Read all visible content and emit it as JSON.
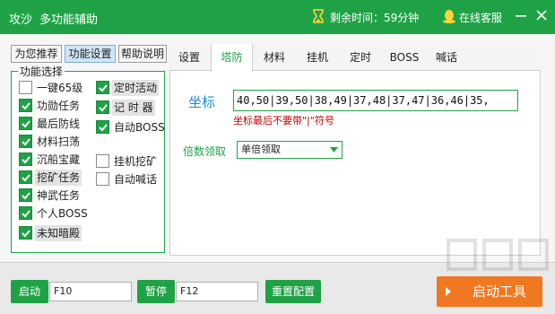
{
  "titlebar": {
    "app_title": "攻沙",
    "subtitle": "多功能辅助",
    "remaining_time": "剩余时间：59分钟",
    "online_service": "在线客服"
  },
  "left_tabs": [
    "为您推荐",
    "功能设置",
    "帮助说明"
  ],
  "function_group": {
    "legend": "功能选择",
    "left_options": [
      {
        "label": "一键65级",
        "checked": false
      },
      {
        "label": "功勋任务",
        "checked": true
      },
      {
        "label": "最后防线",
        "checked": true
      },
      {
        "label": "材料扫荡",
        "checked": true
      },
      {
        "label": "沉船宝藏",
        "checked": true
      },
      {
        "label": "挖矿任务",
        "checked": true
      },
      {
        "label": "神武任务",
        "checked": true
      },
      {
        "label": "个人BOSS",
        "checked": true
      },
      {
        "label": "未知暗殿",
        "checked": true
      }
    ],
    "right_options": [
      {
        "label": "定时活动",
        "checked": true
      },
      {
        "label": "记 时 器",
        "checked": true
      },
      {
        "label": "自动BOSS",
        "checked": true
      },
      {
        "label": "挂机挖矿",
        "checked": false
      },
      {
        "label": "自动喊话",
        "checked": false
      }
    ]
  },
  "right_tabs": [
    "设置",
    "塔防",
    "材料",
    "挂机",
    "定时",
    "BOSS",
    "喊话"
  ],
  "tower_defense": {
    "coord_label": "坐标",
    "coord_value": "40,50|39,50|38,49|37,48|37,47|36,46|35,",
    "coord_hint": "坐标最后不要带\"|\"符号",
    "multiplier_label": "倍数领取",
    "multiplier_value": "单倍领取"
  },
  "bottom": {
    "start_label": "启动",
    "start_key": "F10",
    "pause_label": "暂停",
    "pause_key": "F12",
    "reset_label": "重置配置",
    "start_tool_label": "启动工具"
  },
  "colors": {
    "brand_green": "#1fa246",
    "accent_orange": "#f07820",
    "hint_red": "#c00000",
    "coord_blue": "#1b8fd6"
  }
}
